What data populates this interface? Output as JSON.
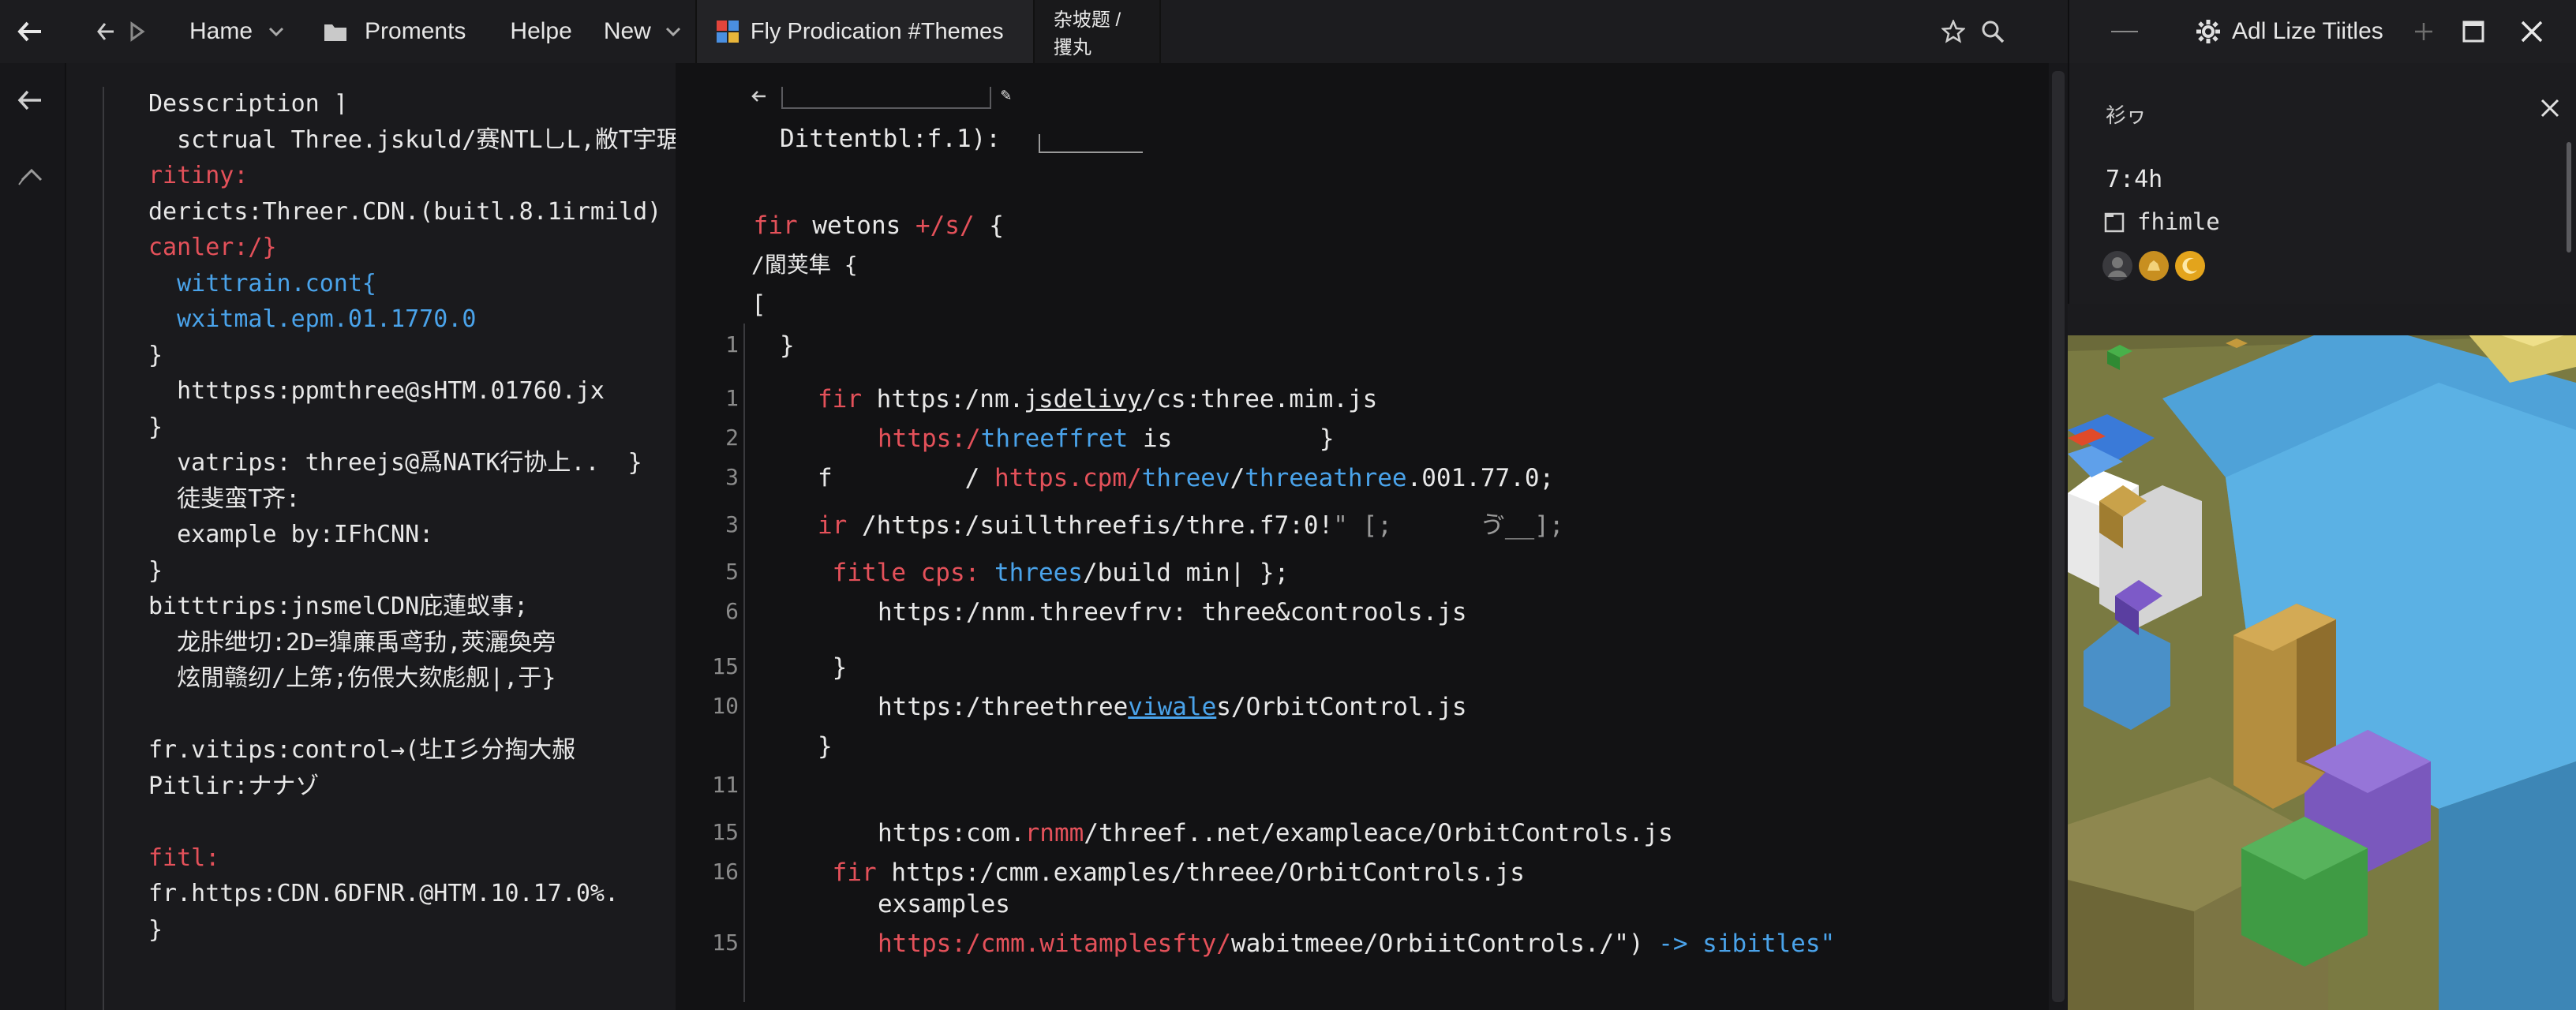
{
  "menu": {
    "items": [
      "Hame",
      "Proments",
      "Helpe",
      "New"
    ]
  },
  "tabs": [
    {
      "label": "Fly Prodication #Themes"
    },
    {
      "label": "杂坡题 / 攫丸"
    }
  ],
  "right_header": {
    "title": "Adl Lize Tiitles"
  },
  "right_panel": {
    "header": "衫ヮ",
    "time": "7:4h",
    "file_label": "fhimle"
  },
  "left_lines": [
    {
      "text": "Desscription ⌉",
      "color": "#e8e8e8"
    },
    {
      "text": "  sctrual Three.jskuld/赛NTL乚L,敝T宇琚,",
      "color": "#e8e8e8"
    },
    {
      "text": "ritiny:",
      "color": "#e4515a"
    },
    {
      "text": "dericts:Threer.CDN.(buitl.8.1irmild)",
      "color": "#e8e8e8"
    },
    {
      "text": "canler:/}",
      "color": "#e4515a"
    },
    {
      "text": "  wittrain.cont{",
      "color": "#4aa3ea"
    },
    {
      "text": "  wxitmal.epm.01.1770.0",
      "color": "#4aa3ea"
    },
    {
      "text": "}",
      "color": "#e8e8e8"
    },
    {
      "text": "  htttpss:ppmthree@sHTM.01760.jx",
      "color": "#e8e8e8"
    },
    {
      "text": "}",
      "color": "#e8e8e8"
    },
    {
      "text": "  vatrips: threejs@爲NATK行协上..  }",
      "color": "#e8e8e8"
    },
    {
      "text": "  徒斐蛮T齐:",
      "color": "#e8e8e8"
    },
    {
      "text": "  example by:IFhCNN:",
      "color": "#e8e8e8"
    },
    {
      "text": "}",
      "color": "#e8e8e8"
    },
    {
      "text": "bitttrips:jnsmelCDN庇蓮蚁事;",
      "color": "#e8e8e8"
    },
    {
      "text": "  龙胩绁切:2D=獋亷禹鸢劧,莢灑奐旁",
      "color": "#e8e8e8"
    },
    {
      "text": "  炫閒赣纫/上笫;伤偎大欬彪舰|,于}",
      "color": "#e8e8e8"
    },
    {
      "text": "",
      "color": "#e8e8e8"
    },
    {
      "text": "fr.vitips:control→(圵I彡分掏大赧",
      "color": "#e8e8e8"
    },
    {
      "text": "Pitlir:ナナゾ",
      "color": "#e8e8e8"
    },
    {
      "text": "",
      "color": "#e8e8e8"
    },
    {
      "text": "fitl:",
      "color": "#e4515a"
    },
    {
      "text": "fr.https:CDN.6DFNR.@HTM.10.17.0%.",
      "color": "#e8e8e8"
    },
    {
      "text": "}",
      "color": "#e8e8e8"
    }
  ],
  "editor": {
    "header_label": "Dittentbl:f.1):",
    "fn_decl": {
      "kw": "fir",
      "rest": " wetons ",
      "op": "+/s/",
      "tail": " {"
    },
    "block_label": "/閬荚隼 {",
    "open_bracket": "[",
    "close_line": "}",
    "rows": [
      {
        "num": "1",
        "indent": 0,
        "segments": [
          {
            "t": "}",
            "c": "#e8e8e8"
          }
        ]
      },
      {
        "num": "1",
        "indent": 1,
        "segments": [
          {
            "t": "fir ",
            "c": "#e4515a"
          },
          {
            "t": "https:/nm.",
            "c": "#e8e8e8"
          },
          {
            "t": "jsdelivy",
            "c": "#e8e8e8",
            "u": true
          },
          {
            "t": "/cs:three.mim.js",
            "c": "#e8e8e8"
          }
        ]
      },
      {
        "num": "2",
        "indent": 2,
        "segments": [
          {
            "t": "https:/",
            "c": "#e4515a"
          },
          {
            "t": "threeffret",
            "c": "#4aa3ea"
          },
          {
            "t": " is          }",
            "c": "#e8e8e8"
          }
        ]
      },
      {
        "num": "3",
        "indent": 1,
        "segments": [
          {
            "t": "f         / ",
            "c": "#e8e8e8"
          },
          {
            "t": "https.cpm/",
            "c": "#e4515a"
          },
          {
            "t": "threev",
            "c": "#4aa3ea"
          },
          {
            "t": "/",
            "c": "#e8e8e8"
          },
          {
            "t": "threeathree",
            "c": "#4aa3ea"
          },
          {
            "t": ".001.77.0;",
            "c": "#e8e8e8"
          }
        ]
      },
      {
        "num": "3",
        "indent": 1,
        "segments": [
          {
            "t": "ir ",
            "c": "#e4515a"
          },
          {
            "t": "/https:/suillthreefis/thre.f7:0!",
            "c": "#e8e8e8"
          },
          {
            "t": "\" [;      ゔ__];",
            "c": "#9a9a9a"
          }
        ]
      },
      {
        "num": "5",
        "indent": 1,
        "segments": [
          {
            "t": " fitle cps:",
            "c": "#e4515a"
          },
          {
            "t": " threes",
            "c": "#4aa3ea"
          },
          {
            "t": "/build min| };",
            "c": "#e8e8e8"
          }
        ]
      },
      {
        "num": "6",
        "indent": 2,
        "segments": [
          {
            "t": "https:/nnm.threevfrv: three",
            "c": "#e8e8e8"
          },
          {
            "t": "&",
            "c": "#e8e8e8"
          },
          {
            "t": "controols.js",
            "c": "#e8e8e8"
          }
        ]
      },
      {
        "num": "15",
        "indent": 1,
        "segments": [
          {
            "t": " }",
            "c": "#e8e8e8"
          }
        ]
      },
      {
        "num": "10",
        "indent": 2,
        "segments": [
          {
            "t": "https:/threethree",
            "c": "#e8e8e8"
          },
          {
            "t": "viwale",
            "c": "#4aa3ea",
            "u": true
          },
          {
            "t": "s/OrbitControl.js",
            "c": "#e8e8e8"
          }
        ]
      },
      {
        "num": "",
        "indent": 1,
        "segments": [
          {
            "t": "}",
            "c": "#e8e8e8"
          }
        ]
      },
      {
        "num": "11",
        "indent": 1,
        "segments": [
          {
            "t": "",
            "c": "#e8e8e8"
          }
        ]
      },
      {
        "num": "15",
        "indent": 2,
        "segments": [
          {
            "t": "https:com.",
            "c": "#e8e8e8"
          },
          {
            "t": "rnmm",
            "c": "#e4515a"
          },
          {
            "t": "/threef..net/exampleace/OrbitControls.js",
            "c": "#e8e8e8"
          }
        ]
      },
      {
        "num": "16",
        "indent": 1,
        "segments": [
          {
            "t": " fir ",
            "c": "#e4515a"
          },
          {
            "t": "https:/cmm.examples/threee/OrbitControls.js",
            "c": "#e8e8e8"
          }
        ]
      },
      {
        "num": "",
        "indent": 2,
        "segments": [
          {
            "t": "exsamples",
            "c": "#e8e8e8"
          }
        ]
      },
      {
        "num": "15",
        "indent": 2,
        "segments": [
          {
            "t": "https:/cmm.witamplesfty/",
            "c": "#e4515a"
          },
          {
            "t": "wabitmeee/OrbiitControls./\")",
            "c": "#e8e8e8"
          },
          {
            "t": " -> sibitles\"",
            "c": "#4aa3ea"
          }
        ]
      }
    ]
  },
  "colors": {
    "accent_red": "#e4515a",
    "accent_blue": "#4aa3ea",
    "bg": "#141416"
  },
  "icons": [
    "back-arrow-icon",
    "nav-back-icon",
    "nav-forward-icon",
    "folder-icon",
    "windows-logo-icon",
    "star-icon",
    "search-icon",
    "minimize-icon",
    "gear-icon",
    "plus-icon",
    "maximize-icon",
    "close-icon"
  ]
}
